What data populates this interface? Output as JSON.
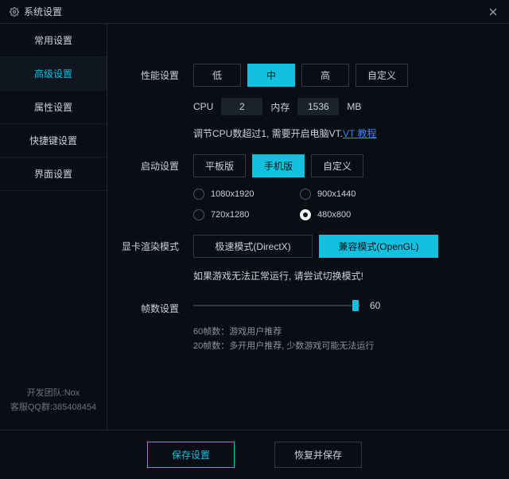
{
  "titlebar": {
    "title": "系统设置"
  },
  "sidebar": {
    "items": [
      {
        "label": "常用设置"
      },
      {
        "label": "高级设置"
      },
      {
        "label": "属性设置"
      },
      {
        "label": "快捷键设置"
      },
      {
        "label": "界面设置"
      }
    ],
    "active_index": 1,
    "footer_team": "开发团队:Nox",
    "footer_qq": "客服QQ群:385408454"
  },
  "performance": {
    "label": "性能设置",
    "options": [
      "低",
      "中",
      "高",
      "自定义"
    ],
    "selected_index": 1,
    "cpu_label": "CPU",
    "cpu_value": "2",
    "mem_label": "内存",
    "mem_value": "1536",
    "mem_unit": "MB",
    "hint_prefix": "调节CPU数超过1, 需要开启电脑VT.",
    "hint_link": "VT 教程"
  },
  "startup": {
    "label": "启动设置",
    "options": [
      "平板版",
      "手机版",
      "自定义"
    ],
    "selected_index": 1,
    "resolutions": [
      "1080x1920",
      "900x1440",
      "720x1280",
      "480x800"
    ],
    "selected_resolution_index": 3
  },
  "render": {
    "label": "显卡渲染模式",
    "options": [
      "极速模式(DirectX)",
      "兼容模式(OpenGL)"
    ],
    "selected_index": 1,
    "warn": "如果游戏无法正常运行, 请尝试切换模式!"
  },
  "fps": {
    "label": "帧数设置",
    "value": "60",
    "min": 20,
    "max": 60,
    "note1": "60帧数：游戏用户推荐",
    "note2": "20帧数：多开用户推荐, 少数游戏可能无法运行"
  },
  "footer": {
    "save": "保存设置",
    "restore": "恢复并保存"
  }
}
